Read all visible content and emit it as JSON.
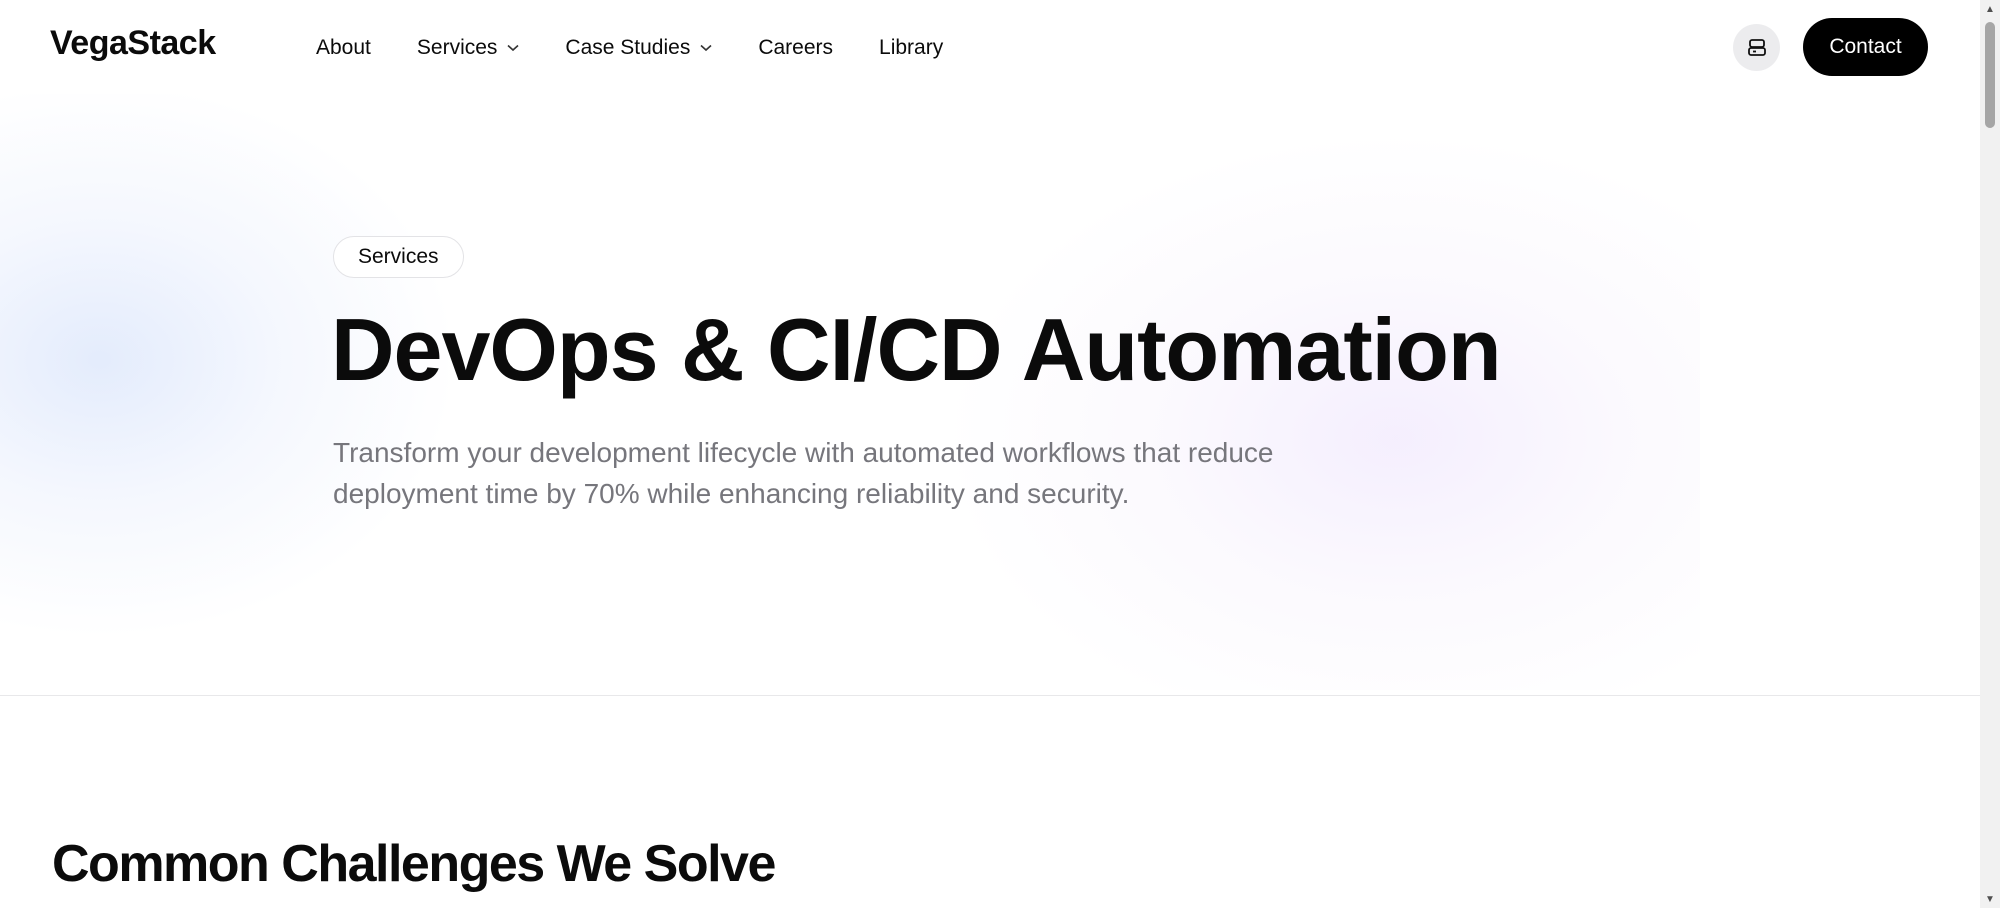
{
  "brand": {
    "name": "VegaStack"
  },
  "nav": {
    "items": [
      {
        "label": "About",
        "has_dropdown": false
      },
      {
        "label": "Services",
        "has_dropdown": true
      },
      {
        "label": "Case Studies",
        "has_dropdown": true
      },
      {
        "label": "Careers",
        "has_dropdown": false
      },
      {
        "label": "Library",
        "has_dropdown": false
      }
    ],
    "icon_button": "printer-icon",
    "contact_label": "Contact"
  },
  "hero": {
    "badge": "Services",
    "title": "DevOps & CI/CD Automation",
    "subtitle": "Transform your development lifecycle with automated workflows that reduce deployment time by 70% while enhancing reliability and security."
  },
  "section": {
    "title": "Common Challenges We Solve"
  },
  "colors": {
    "text": "#0b0b0b",
    "muted": "#76767c",
    "button_bg": "#000000",
    "button_text": "#ffffff",
    "icon_button_bg": "#ececee"
  }
}
